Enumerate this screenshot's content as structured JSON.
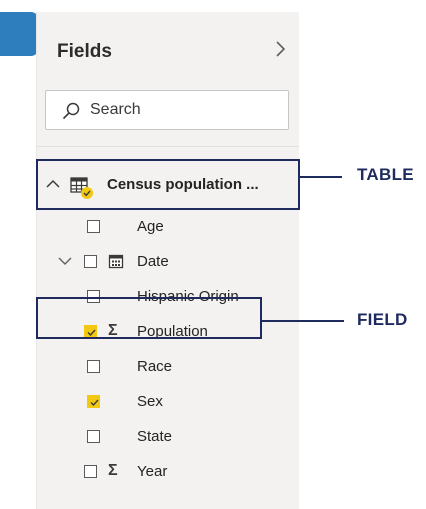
{
  "panel": {
    "title": "Fields",
    "expand_icon": "chevron-right-icon",
    "accent_color": "#2e7dbd"
  },
  "search": {
    "placeholder": "Search",
    "value": ""
  },
  "table": {
    "name": "Census population ...",
    "expanded": true,
    "icon": "table-icon"
  },
  "fields": [
    {
      "label": "Age",
      "checked": false,
      "icon": "",
      "expandable": false
    },
    {
      "label": "Date",
      "checked": false,
      "icon": "calendar-icon",
      "expandable": true
    },
    {
      "label": "Hispanic Origin",
      "checked": false,
      "icon": "",
      "expandable": false
    },
    {
      "label": "Population",
      "checked": true,
      "icon": "sigma-icon",
      "expandable": false
    },
    {
      "label": "Race",
      "checked": false,
      "icon": "",
      "expandable": false
    },
    {
      "label": "Sex",
      "checked": true,
      "icon": "",
      "expandable": false
    },
    {
      "label": "State",
      "checked": false,
      "icon": "",
      "expandable": false
    },
    {
      "label": "Year",
      "checked": false,
      "icon": "sigma-icon",
      "expandable": false
    }
  ],
  "annotations": {
    "table_label": "TABLE",
    "field_label": "FIELD",
    "color": "#1f2a5e"
  },
  "colors": {
    "checked": "#f2c811",
    "panel_bg": "#f3f2f1"
  }
}
